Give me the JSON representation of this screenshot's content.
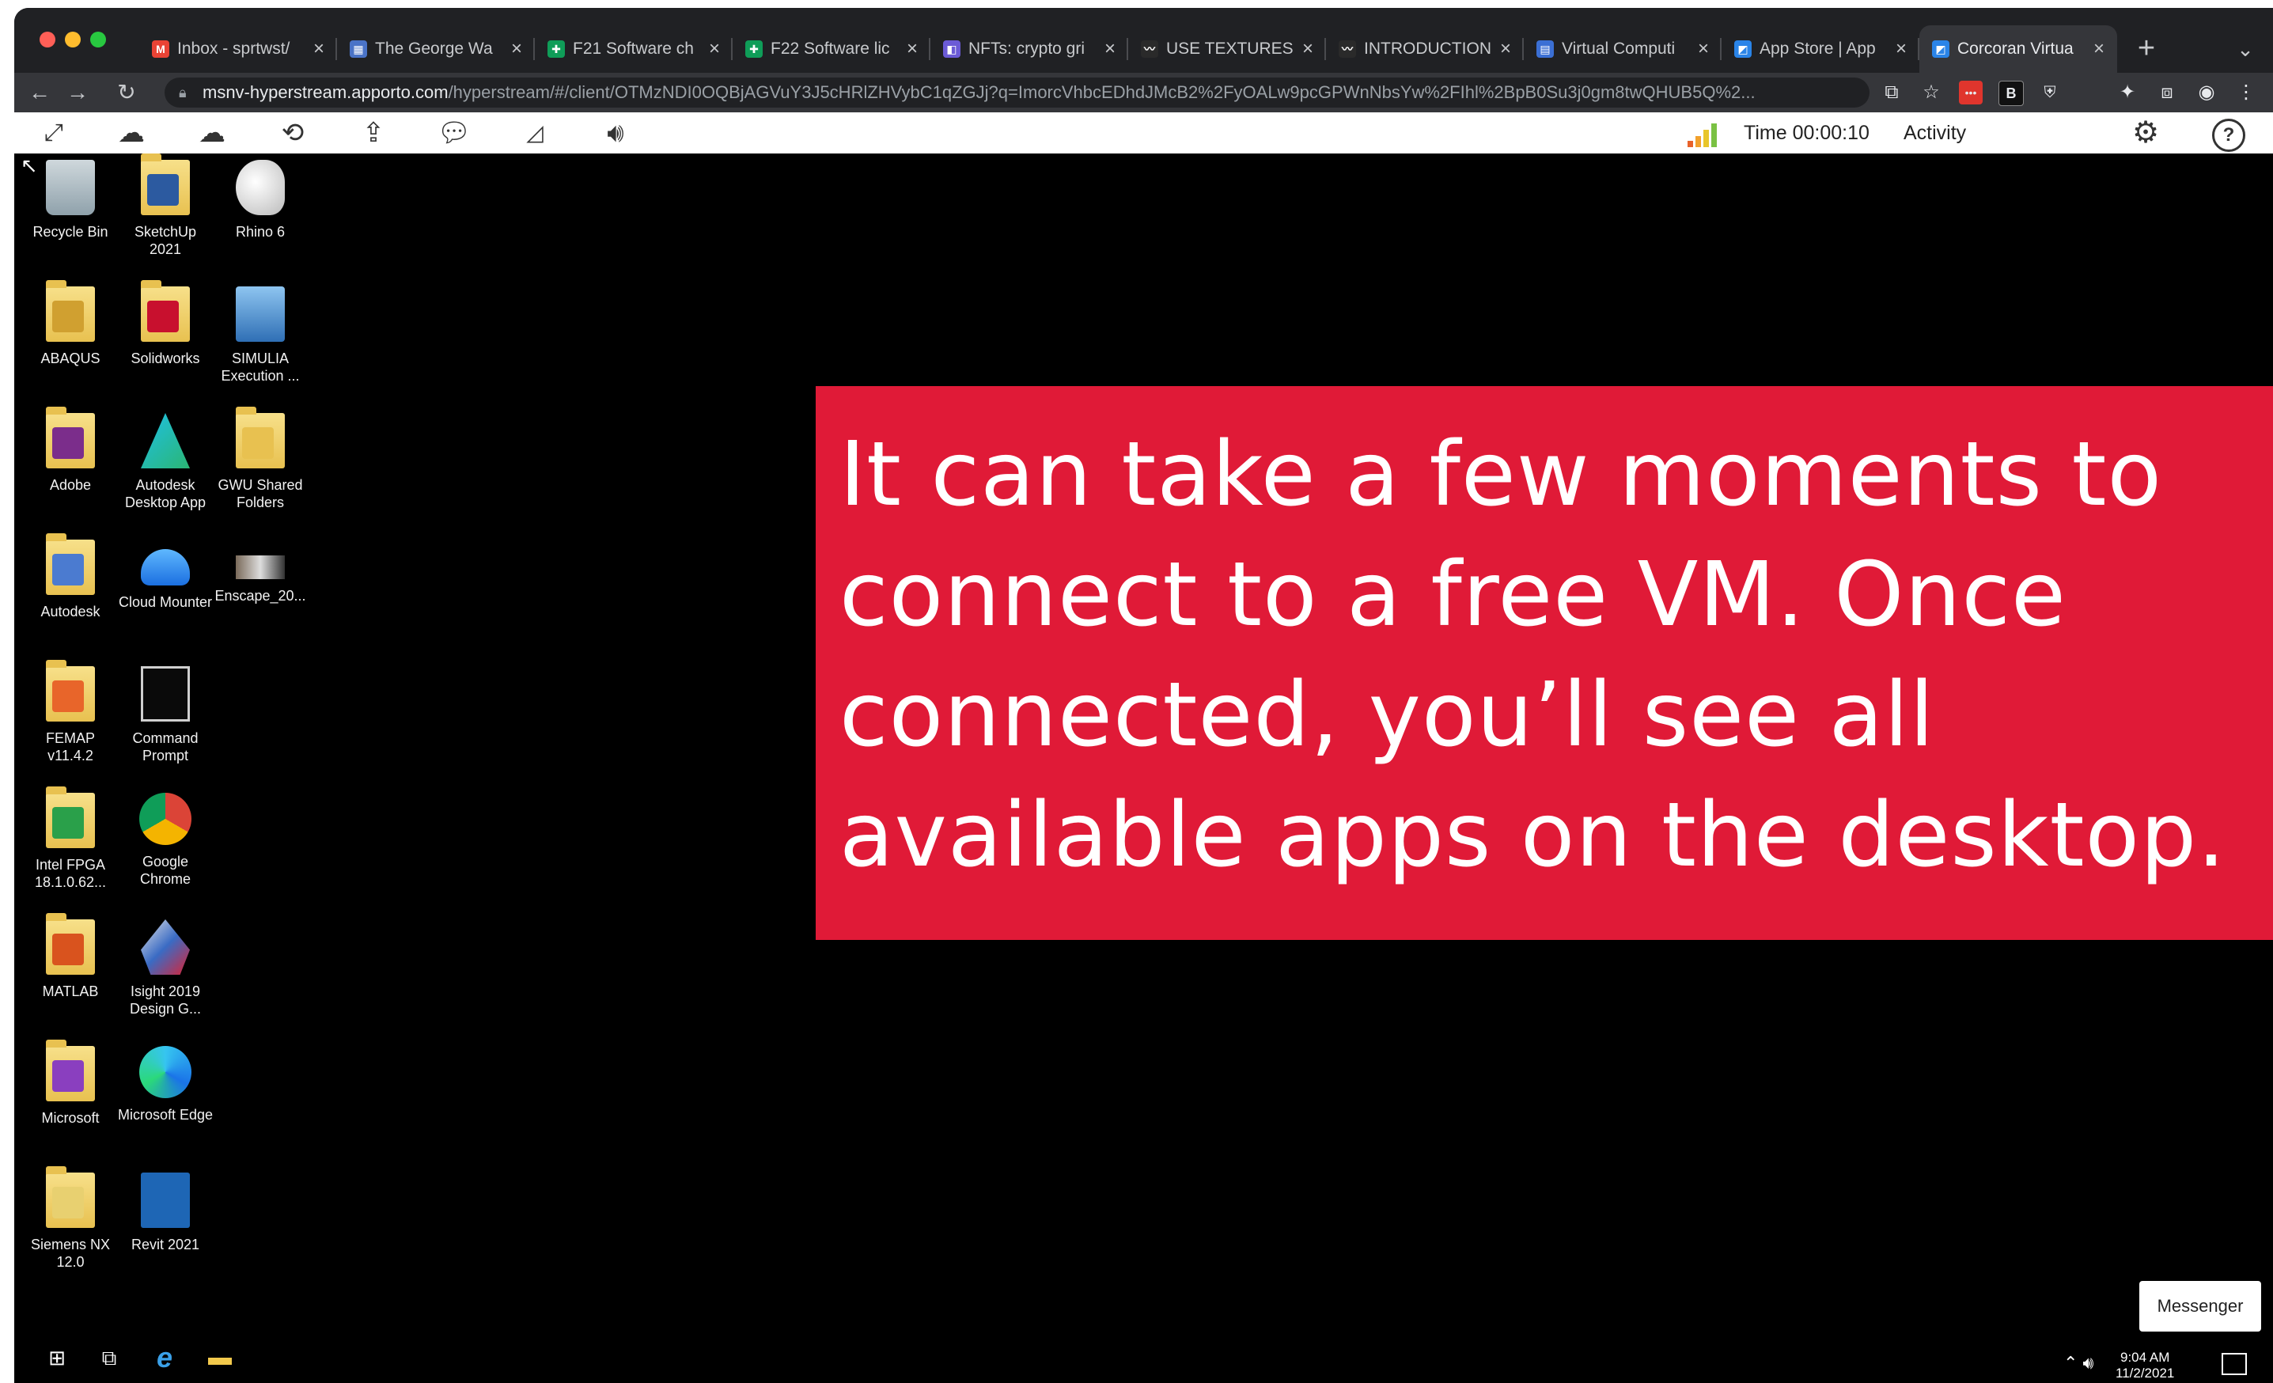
{
  "browser": {
    "tabs": [
      {
        "label": "Inbox - sprtwst/",
        "icon": "gmail-icon",
        "color": "#ea4335",
        "glyph": "M"
      },
      {
        "label": "The George Wa",
        "icon": "gwu-icon",
        "color": "#4a73c7",
        "glyph": "▦"
      },
      {
        "label": "F21 Software ch",
        "icon": "sheets-icon",
        "color": "#0f9d58",
        "glyph": "✚"
      },
      {
        "label": "F22 Software lic",
        "icon": "sheets-icon",
        "color": "#0f9d58",
        "glyph": "✚"
      },
      {
        "label": "NFTs: crypto gri",
        "icon": "nft-icon",
        "color": "#6b5bd6",
        "glyph": "◧"
      },
      {
        "label": "USE TEXTURES",
        "icon": "textures-icon",
        "color": "#2a2a2a",
        "glyph": "〰"
      },
      {
        "label": "INTRODUCTION",
        "icon": "intro-icon",
        "color": "#2a2a2a",
        "glyph": "〰"
      },
      {
        "label": "Virtual Computi",
        "icon": "virtual-icon",
        "color": "#3b6fd4",
        "glyph": "▤"
      },
      {
        "label": "App Store | App",
        "icon": "appstore-icon",
        "color": "#2a84e8",
        "glyph": "◩"
      },
      {
        "label": "Corcoran Virtua",
        "icon": "corcoran-icon",
        "color": "#2a84e8",
        "glyph": "◩",
        "active": true
      }
    ],
    "new_tab": "+",
    "tab_menu": "⌄",
    "url_host": "msnv-hyperstream.apporto.com",
    "url_rest": "/hyperstream/#/client/OTMzNDI0OQBjAGVuY3J5cHRlZHVybC1qZGJj?q=ImorcVhbcEDhdJMcB2%2FyOALw9pcGPWnNbsYw%2FIhl%2BpB0Su3j0gm8twQHUB5Q%2..."
  },
  "stream_toolbar": {
    "time_label": "Time 00:00:10",
    "activity_label": "Activity",
    "help_glyph": "?"
  },
  "desktop_icons": [
    {
      "label": "Recycle Bin",
      "name": "recycle-bin-icon"
    },
    {
      "label": "SketchUp 2021",
      "name": "sketchup-icon"
    },
    {
      "label": "Rhino 6",
      "name": "rhino-icon"
    },
    {
      "label": "ABAQUS",
      "name": "abaqus-icon"
    },
    {
      "label": "Solidworks",
      "name": "solidworks-icon"
    },
    {
      "label": "SIMULIA Execution ...",
      "name": "simulia-icon"
    },
    {
      "label": "Adobe",
      "name": "adobe-icon"
    },
    {
      "label": "Autodesk Desktop App",
      "name": "autodesk-desktop-app-icon"
    },
    {
      "label": "GWU Shared Folders",
      "name": "gwu-shared-folders-icon"
    },
    {
      "label": "Autodesk",
      "name": "autodesk-icon"
    },
    {
      "label": "Cloud Mounter",
      "name": "cloud-mounter-icon"
    },
    {
      "label": "Enscape_20...",
      "name": "enscape-icon"
    },
    {
      "label": "FEMAP v11.4.2",
      "name": "femap-icon"
    },
    {
      "label": "Command Prompt",
      "name": "command-prompt-icon"
    },
    {
      "label": "Intel FPGA 18.1.0.62...",
      "name": "intel-fpga-icon"
    },
    {
      "label": "Google Chrome",
      "name": "google-chrome-icon"
    },
    {
      "label": "MATLAB",
      "name": "matlab-icon"
    },
    {
      "label": "Isight 2019 Design G...",
      "name": "isight-icon"
    },
    {
      "label": "Microsoft",
      "name": "microsoft-icon"
    },
    {
      "label": "Microsoft Edge",
      "name": "microsoft-edge-icon"
    },
    {
      "label": "Siemens NX 12.0",
      "name": "siemens-nx-icon"
    },
    {
      "label": "Revit 2021",
      "name": "revit-icon"
    }
  ],
  "banner": {
    "text": "It can take a few moments to\nconnect to a free VM. Once\nconnected, you’ll see all\navailable apps on the desktop.",
    "color": "#e01a37"
  },
  "taskbar": {
    "messenger_label": "Messenger",
    "clock_time": "9:04 AM",
    "clock_date": "11/2/2021"
  }
}
